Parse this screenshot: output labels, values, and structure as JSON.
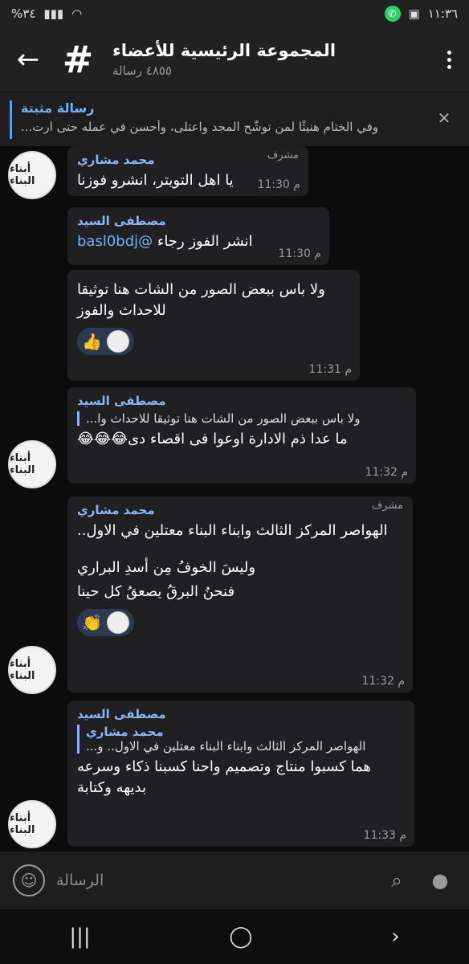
{
  "status": {
    "time": "١١:٣٦",
    "battery": "%٣٤"
  },
  "header": {
    "title": "المجموعة الرئيسية للأعضاء",
    "subtitle": "٤٨٥٥ رسالة"
  },
  "pinned": {
    "title": "رسالة مثبتة",
    "text": "وفي الختام هنيئًا لمن توشَّح المجد واعتلى، وأحسن في عمله حتى ارت..."
  },
  "messages": [
    {
      "sender": "محمد مشاري",
      "role": "مشرف",
      "text": "يا اهل التويتر، انشرو فوزنا",
      "time": "11:30 م"
    },
    {
      "sender": "مصطفى السيد",
      "text_prefix": "انشر الفوز رجاء ",
      "mention": "@basl0bdj",
      "time": "11:30 م"
    },
    {
      "text": "ولا باس ببعض الصور من الشات هنا توثيقا للاحداث والفوز",
      "reaction": "👍",
      "time": "11:31 م"
    },
    {
      "sender": "مصطفى السيد",
      "reply_text": "ولا باس ببعض الصور من الشات هنا توثيقا للاحداث وا...",
      "text": "ما عدا ذم الادارة اوعوا فى اقصاء دى😂😂😂",
      "time": "11:32 م"
    },
    {
      "sender": "محمد مشاري",
      "role": "مشرف",
      "text1": "الهواصر المركز الثالث وابناء البناء معتلين في الاول..",
      "text2": "وليسَ الخوفُ مِن أسدِ البراري",
      "text3": "فنحنُ البرقُ يصعقُ كل حينا",
      "reaction": "👏",
      "time": "11:32 م"
    },
    {
      "sender": "مصطفى السيد",
      "reply_name": "محمد مشاري",
      "reply_text": "الهواصر المركز الثالث وابناء البناء معتلين في الاول..  و...",
      "text": "هما كسبوا منتاج وتصميم واحنا كسبنا ذكاء وسرعه بديهه وكتابة",
      "time": "11:33 م"
    }
  ],
  "input": {
    "placeholder": "الرسالة"
  },
  "avatar_label": "أبناء البناء",
  "colors": {
    "accent": "#8ab4f8",
    "bubble": "#202023",
    "reaction_bg": "#2b3a52"
  }
}
